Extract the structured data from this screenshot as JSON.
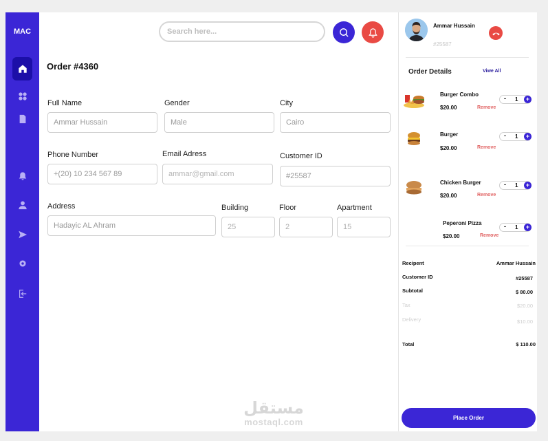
{
  "sidebar": {
    "logo": "MAC",
    "items": [
      {
        "icon": "home-icon",
        "active": true
      },
      {
        "icon": "grid-icon",
        "active": false
      },
      {
        "icon": "file-icon",
        "active": false
      },
      {
        "icon": "bell-icon",
        "active": false
      },
      {
        "icon": "user-icon",
        "active": false
      },
      {
        "icon": "send-icon",
        "active": false
      },
      {
        "icon": "settings-icon",
        "active": false
      },
      {
        "icon": "logout-icon",
        "active": false
      }
    ]
  },
  "header": {
    "search_placeholder": "Search here...",
    "search_icon": "search-icon",
    "bell_icon": "bell-icon"
  },
  "order": {
    "title": "Order #4360",
    "fields": {
      "full_name": {
        "label": "Full Name",
        "value": "Ammar Hussain"
      },
      "gender": {
        "label": "Gender",
        "value": "Male"
      },
      "city": {
        "label": "City",
        "value": "Cairo"
      },
      "phone": {
        "label": "Phone Number",
        "value": "+(20) 10 234 567 89"
      },
      "email": {
        "label": "Email Adress",
        "placeholder": "ammar@gmail.com"
      },
      "customer_id": {
        "label": "Customer ID",
        "value": "#25587"
      },
      "address": {
        "label": "Address",
        "value": "Hadayic AL Ahram"
      },
      "building": {
        "label": "Building",
        "value": "25"
      },
      "floor": {
        "label": "Floor",
        "value": "2"
      },
      "apartment": {
        "label": "Apartment",
        "value": "15"
      }
    }
  },
  "customer": {
    "name": "Ammar Hussain",
    "id": "#25587"
  },
  "order_details": {
    "title": "Order Details",
    "view_all": "Viwe All",
    "items": [
      {
        "name": "Burger Combo",
        "price": "$20.00",
        "qty": "1",
        "remove": "Remove",
        "minus": "-",
        "plus": "+"
      },
      {
        "name": "Burger",
        "price": "$20.00",
        "qty": "1",
        "remove": "Remove",
        "minus": "-",
        "plus": "+"
      },
      {
        "name": "Chicken Burger",
        "price": "$20.00",
        "qty": "1",
        "remove": "Remove",
        "minus": "-",
        "plus": "+"
      },
      {
        "name": "Peperoni Pizza",
        "price": "$20.00",
        "qty": "1",
        "remove": "Remove",
        "minus": "-",
        "plus": "+"
      }
    ]
  },
  "summary": {
    "recipient_label": "Recipent",
    "recipient_value": "Ammar Hussain",
    "customer_id_label": "Customer ID",
    "customer_id_value": "#25587",
    "subtotal_label": "Subtotal",
    "subtotal_value": "$ 80.00",
    "tax_label": "Tax",
    "tax_value": "$20.00",
    "delivery_label": "Delivery",
    "delivery_value": "$10.00",
    "total_label": "Total",
    "total_value": "$ 110.00"
  },
  "place_order": "Place Order",
  "watermark": {
    "arabic": "مستقل",
    "latin": "mostaql.com"
  },
  "colors": {
    "primary": "#3b26d6",
    "danger": "#e94a44",
    "remove": "#e06060"
  }
}
